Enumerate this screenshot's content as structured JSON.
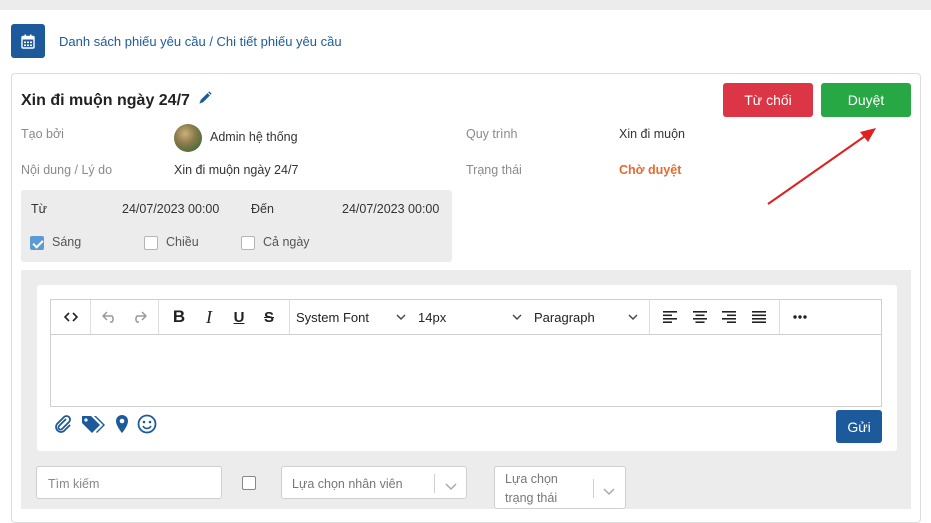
{
  "breadcrumb": "Danh sách phiếu yêu cầu / Chi tiết phiếu yêu cầu",
  "title": "Xin đi muộn ngày 24/7",
  "buttons": {
    "reject": "Từ chối",
    "approve": "Duyệt",
    "send": "Gửi"
  },
  "details": {
    "created_by_label": "Tạo bởi",
    "created_by_value": "Admin hệ thống",
    "content_label": "Nội dung / Lý do",
    "content_value": "Xin đi muộn ngày 24/7",
    "process_label": "Quy trình",
    "process_value": "Xin đi muộn",
    "status_label": "Trạng thái",
    "status_value": "Chờ duyệt"
  },
  "time": {
    "from_label": "Từ",
    "from_value": "24/07/2023 00:00",
    "to_label": "Đến",
    "to_value": "24/07/2023 00:00",
    "options": [
      {
        "label": "Sáng",
        "checked": true
      },
      {
        "label": "Chiều",
        "checked": false
      },
      {
        "label": "Cả ngày",
        "checked": false
      }
    ]
  },
  "editor": {
    "font_family": "System Font",
    "font_size": "14px",
    "block_format": "Paragraph"
  },
  "filters": {
    "search_placeholder": "Tìm kiếm",
    "employee_select": "Lựa chọn nhân viên",
    "status_select_line1": "Lựa chọn",
    "status_select_line2": "trạng thái"
  },
  "colors": {
    "primary": "#1d5a9c",
    "reject": "#dc3545",
    "approve": "#28a745",
    "status": "#e8692d",
    "annotation_arrow": "#e02020"
  },
  "icons": [
    "calendar-icon",
    "pencil-icon",
    "code-icon",
    "undo-icon",
    "redo-icon",
    "bold-icon",
    "italic-icon",
    "underline-icon",
    "strikethrough-icon",
    "align-left-icon",
    "align-center-icon",
    "align-right-icon",
    "align-justify-icon",
    "more-icon",
    "paperclip-icon",
    "tags-icon",
    "map-marker-icon",
    "smile-icon",
    "chevron-down-icon"
  ]
}
